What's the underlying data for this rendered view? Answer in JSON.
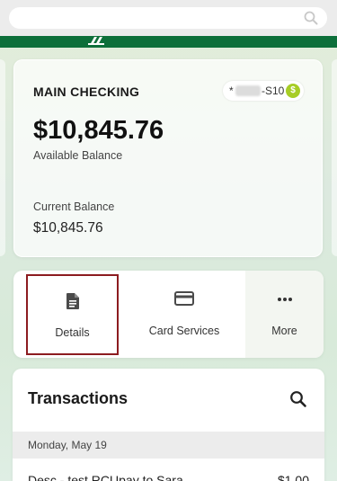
{
  "header": {
    "search_placeholder": "",
    "brand_color": "#0d6f3a"
  },
  "account": {
    "name": "MAIN CHECKING",
    "masked_prefix": "*",
    "suffix": "-S10",
    "balance": "$10,845.76",
    "available_label": "Available Balance",
    "current_label": "Current Balance",
    "current_value": "$10,845.76",
    "badge_color": "#a7cd25",
    "badge_symbol": "$"
  },
  "actions": [
    {
      "label": "Details",
      "icon": "document-icon"
    },
    {
      "label": "Card Services",
      "icon": "credit-card-icon"
    },
    {
      "label": "More",
      "icon": "more-dots-icon"
    }
  ],
  "transactions": {
    "title": "Transactions",
    "date": "Monday, May 19",
    "first_row_desc": "Desc - test RCUpay to Sara",
    "first_row_amount": "$1.00"
  }
}
